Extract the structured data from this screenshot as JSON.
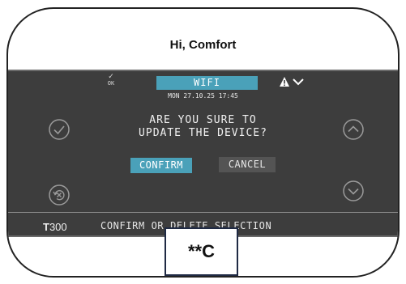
{
  "greeting": "Hi, Comfort",
  "status_bar": {
    "ok_label": "OK",
    "mode_tab": "WIFI",
    "alert_icon": "warning-triangle-icon",
    "menu_icon": "chevron-down-icon"
  },
  "datetime": "MON 27.10.25 17:45",
  "dialog": {
    "line1": "ARE YOU SURE TO",
    "line2": "UPDATE THE DEVICE?",
    "confirm_label": "CONFIRM",
    "cancel_label": "CANCEL"
  },
  "footer": {
    "model_prefix": "T",
    "model_number": "300",
    "hint": "CONFIRM OR DELETE SELECTION"
  },
  "code_box": "**C",
  "colors": {
    "panel": "#3d3d3d",
    "accent": "#4aa1b9",
    "button_secondary": "#545454"
  }
}
